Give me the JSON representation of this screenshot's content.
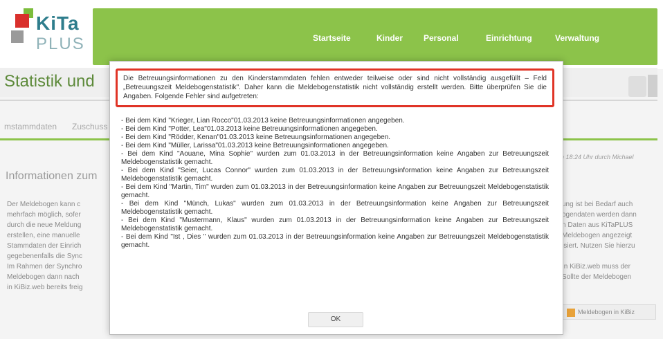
{
  "header": {
    "logo_text_top": "KiTa",
    "logo_text_bottom": "PLUS",
    "nav": [
      "Startseite",
      "Kinder",
      "Personal",
      "Einrichtung",
      "Verwaltung"
    ]
  },
  "page": {
    "title": "Statistik und",
    "tabs": [
      "mstammdaten",
      "Zuschuss"
    ],
    "section_title": "Informationen zum",
    "note_right": "n 18:24 Uhr durch Michael",
    "body_left": [
      "Der Meldebogen kann c",
      "mehrfach möglich, sofer",
      "durch die neue Meldung",
      "erstellen, eine manuelle",
      "Stammdaten der Einrich",
      "gegebenenfalls die Sync",
      "Im Rahmen der Synchro",
      "Meldebogen dann nach",
      "in KiBiz.web bereits freig"
    ],
    "body_right": [
      "ung ist bei Bedarf auch",
      "ogendaten werden dann",
      "n Daten aus KiTaPLUS",
      "Meldebogen angezeigt",
      "isiert. Nutzen Sie hierzu",
      "",
      "In KiBiz.web muss der",
      "Sollte der Meldebogen",
      ""
    ],
    "meldebogen_button": "Meldebogen in KiBiz"
  },
  "modal": {
    "message": "Die Betreuungsinformationen zu den Kinderstammdaten fehlen entweder teilweise oder sind nicht vollständig ausgefüllt – Feld „Betreuungszeit Meldebogenstatistik\". Daher kann die Meldebogenstatistik nicht vollständig erstellt werden. Bitte überprüfen Sie die Angaben. Folgende Fehler sind aufgetreten:",
    "errors": [
      "- Bei dem Kind \"Krieger, Lian Rocco\"01.03.2013 keine Betreuungsinformationen angegeben.",
      "- Bei dem Kind \"Potter, Lea\"01.03.2013 keine Betreuungsinformationen angegeben.",
      "- Bei dem Kind \"Rödder, Kenan\"01.03.2013 keine Betreuungsinformationen angegeben.",
      "- Bei dem Kind \"Müller, Larissa\"01.03.2013 keine Betreuungsinformationen angegeben.",
      "- Bei dem Kind \"Aouane, Mina Sophie\" wurden zum 01.03.2013 in der Betreuungsinformation keine Angaben zur Betreuungszeit Meldebogenstatistik gemacht.",
      "- Bei dem Kind \"Seier, Lucas Connor\" wurden zum 01.03.2013 in der Betreuungsinformation keine Angaben zur Betreuungszeit Meldebogenstatistik gemacht.",
      "- Bei dem Kind \"Martin, Tim\" wurden zum 01.03.2013 in der Betreuungsinformation keine Angaben zur Betreuungszeit Meldebogenstatistik gemacht.",
      "- Bei dem Kind \"Münch, Lukas\" wurden zum 01.03.2013 in der Betreuungsinformation keine Angaben zur Betreuungszeit Meldebogenstatistik gemacht.",
      "- Bei dem Kind \"Mustermann, Klaus\" wurden zum 01.03.2013 in der Betreuungsinformation keine Angaben zur Betreuungszeit Meldebogenstatistik gemacht.",
      "- Bei dem Kind \"Ist , Dies \" wurden zum 01.03.2013 in der Betreuungsinformation keine Angaben zur Betreuungszeit Meldebogenstatistik gemacht."
    ],
    "ok_label": "OK"
  },
  "colors": {
    "nav_green": "#8cc34a",
    "highlight_red": "#e03426",
    "logo_teal": "#2e7d8c"
  }
}
